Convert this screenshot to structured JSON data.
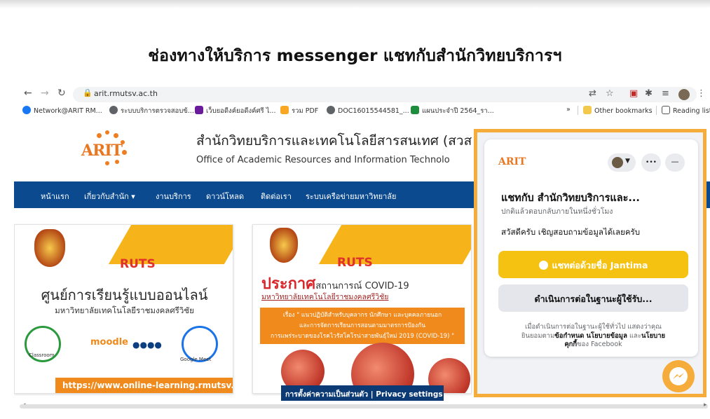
{
  "headline": "ช่องทางให้บริการ messenger แชทกับสำนักวิทยบริการฯ",
  "browser": {
    "url": "arit.rmutsv.ac.th",
    "bookmarks": [
      {
        "label": "Network@ARIT RM...",
        "color": "#1877f2"
      },
      {
        "label": "ระบบบริการตรวจสอบข้...",
        "color": "#5f6368"
      },
      {
        "label": "เว็บยอดีงค์ยอดีงค์ศรี ไ...",
        "color": "#6a1b9a"
      },
      {
        "label": "รวม PDF",
        "color": "#f9a825"
      },
      {
        "label": "DOC16015544581_...",
        "color": "#5f6368"
      },
      {
        "label": "แผนประจำปี 2564_รา...",
        "color": "#1e8e3e"
      }
    ],
    "more": "»",
    "other_bookmarks": "Other bookmarks",
    "reading_list": "Reading list"
  },
  "site": {
    "logo": "ARIT",
    "title": "สำนักวิทยบริการและเทคโนโลยีสารสนเทศ (สวส",
    "subtitle": "Office of Academic Resources and Information Technolo",
    "nav": [
      "หน้าแรก",
      "เกี่ยวกับสำนัก ▾",
      "งานบริการ",
      "ดาวน์โหลด",
      "ติดต่อเรา",
      "ระบบเครือข่ายมหาวิทยาลัย"
    ]
  },
  "card_online": {
    "brand": "RUTS",
    "title": "ศูนย์การเรียนรู้แบบออนไลน์",
    "subtitle": "มหาวิทยาลัยเทคโนโลยีราชมงคลศรีวิชัย",
    "apps": [
      "Classroom",
      "moodle",
      "Google Meet"
    ],
    "url": "https://www.online-learning.rmutsv.ac.th"
  },
  "card_covid": {
    "brand": "RUTS",
    "heading": "ประกาศ",
    "heading_small": "สถานการณ์ COVID-19",
    "uni": "มหาวิทยาลัยเทคโนโลยีราชมงคลศรีวิชัย",
    "body_1": "เรื่อง \" แนวปฏิบัติสำหรับบุคลากร นักศึกษา และบุคคลภายนอก",
    "body_2": "และการจัดการเรียนการสอนตามมาตรการป้องกัน",
    "body_3": "การแพร่ระบาดของโรคไวรัสโคโรน่าสายพันธุ์ใหม่ 2019 (COVID-19) \""
  },
  "privacy_settings": "การตั้งค่าความเป็นส่วนตัว | Privacy settings",
  "chat": {
    "logo": "ARIT",
    "title": "แชทกับ สำนักวิทยบริการและ...",
    "subtitle": "ปกติแล้วตอบกลับภายในหนึ่งชั่วโมง",
    "greeting": "สวัสดีครับ เชิญสอบถามข้อมูลได้เลยครับ",
    "primary_button": "แชทต่อด้วยชื่อ Jantima",
    "secondary_button": "ดำเนินการต่อในฐานะผู้ใช้รับ...",
    "terms_1": "เมื่อดำเนินการต่อในฐานะผู้ใช้ทั่วไป แสดงว่าคุณ",
    "terms_2a": "ยินยอมตาม",
    "terms_2b": "ข้อกำหนด",
    "terms_2c": "นโยบายข้อมูล",
    "terms_2d": "และ",
    "terms_2e": "นโยบาย",
    "terms_3a": "คุกกี้",
    "terms_3b": "ของ Facebook",
    "more_icon": "•••",
    "minimize_icon": "—"
  },
  "colors": {
    "accent_orange": "#f6ac3a",
    "nav_blue": "#0c4a8f",
    "chat_yellow": "#f5c211"
  }
}
